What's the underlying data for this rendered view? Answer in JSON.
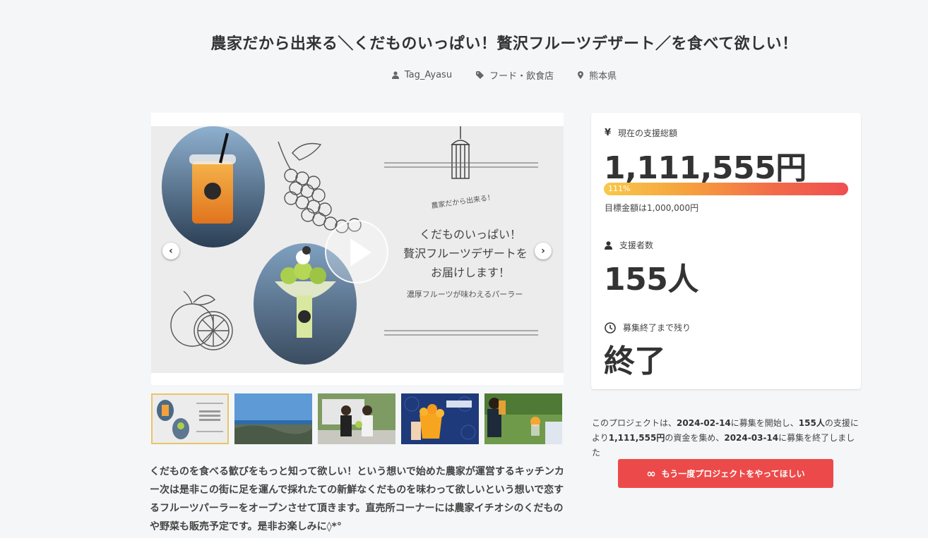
{
  "project": {
    "title": "農家だから出来る＼くだものいっぱい！贅沢フルーツデザート／を食べて欲しい！",
    "owner": "Tag_Ayasu",
    "category": "フード・飲食店",
    "location": "熊本県"
  },
  "slide": {
    "tagline": "農家だから出来る！",
    "headline_1": "くだものいっぱい！",
    "headline_2": "贅沢フルーツデザートを",
    "headline_3": "お届けします！",
    "subline": "濃厚フルーツが味わえるパーラー"
  },
  "stats": {
    "total_label": "現在の支援総額",
    "total_value": "1,111,555円",
    "progress_text": "111%",
    "progress_fraction": 1.11,
    "goal_text": "目標金額は1,000,000円",
    "supporters_label": "支援者数",
    "supporters_value": "155人",
    "remaining_label": "募集終了まで残り",
    "remaining_value": "終了"
  },
  "summary": {
    "p1": "このプロジェクトは、",
    "start": "2024-02-14",
    "p2": "に募集を開始し、",
    "supporters": "155人",
    "p3": "の支援により",
    "amount": "1,111,555円",
    "p4": "の資金を集め、",
    "end": "2024-03-14",
    "p5": "に募集を終了しました"
  },
  "cta": {
    "label": "もう一度プロジェクトをやってほしい"
  },
  "description": "くだものを食べる歓びをもっと知って欲しい！という想いで始めた農家が運営するキッチンカー次は是非この街に足を運んで採れたての新鮮なくだものを味わって欲しいという想いで恋するフルーツパーラーをオープンさせて頂きます。直売所コーナーには農家イチオシのくだものや野菜も販売予定です。是非お楽しみに◊*°",
  "colors": {
    "accent": "#ec4a4a",
    "background": "#f5f6f7"
  }
}
